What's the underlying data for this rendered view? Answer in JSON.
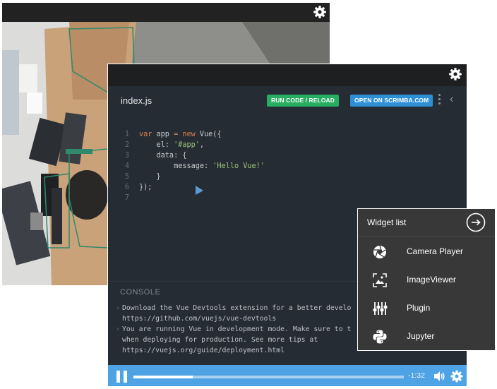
{
  "camera_window": {
    "settings_icon": "gear-icon"
  },
  "editor": {
    "file_name": "index.js",
    "run_button": "RUN CODE / RELOAD",
    "open_button": "OPEN ON SCRIMBA.COM",
    "code_lines": [
      {
        "num": "1",
        "parts": [
          [
            "kw",
            "var"
          ],
          [
            "tx",
            " app "
          ],
          [
            "kw",
            "="
          ],
          [
            "tx",
            " "
          ],
          [
            "kw",
            "new"
          ],
          [
            "tx",
            " Vue({"
          ]
        ]
      },
      {
        "num": "2",
        "parts": [
          [
            "tx",
            "    el: "
          ],
          [
            "st",
            "'#app'"
          ],
          [
            "tx",
            ","
          ]
        ]
      },
      {
        "num": "3",
        "parts": [
          [
            "tx",
            "    data: {"
          ]
        ]
      },
      {
        "num": "4",
        "parts": [
          [
            "tx",
            "        message: "
          ],
          [
            "st",
            "'Hello Vue!'"
          ]
        ]
      },
      {
        "num": "5",
        "parts": [
          [
            "tx",
            "    }"
          ]
        ]
      },
      {
        "num": "6",
        "parts": [
          [
            "tx",
            "});"
          ]
        ]
      },
      {
        "num": "7",
        "parts": []
      }
    ],
    "console_title": "CONSOLE",
    "console_lines": [
      {
        "caret": true,
        "text": "Download the Vue Devtools extension for a better develo"
      },
      {
        "caret": false,
        "text": "https://github.com/vuejs/vue-devtools"
      },
      {
        "caret": true,
        "text": "You are running Vue in development mode. Make sure to t"
      },
      {
        "caret": false,
        "text": "when deploying for production. See more tips at"
      },
      {
        "caret": false,
        "text": "https://vuejs.org/guide/deployment.html"
      }
    ],
    "player": {
      "time_remaining": "-1:32",
      "progress": 0.22
    }
  },
  "widget_list": {
    "title": "Widget list",
    "items": [
      {
        "label": "Camera Player",
        "icon": "aperture-icon"
      },
      {
        "label": "ImageViewer",
        "icon": "image-frame-icon"
      },
      {
        "label": "Plugin",
        "icon": "sliders-icon"
      },
      {
        "label": "Jupyter",
        "icon": "python-icon"
      }
    ]
  },
  "colors": {
    "run_button": "#27ae60",
    "open_button": "#2d8fd5",
    "player_bar": "#4ea3e5",
    "widget_bg": "#383838"
  }
}
